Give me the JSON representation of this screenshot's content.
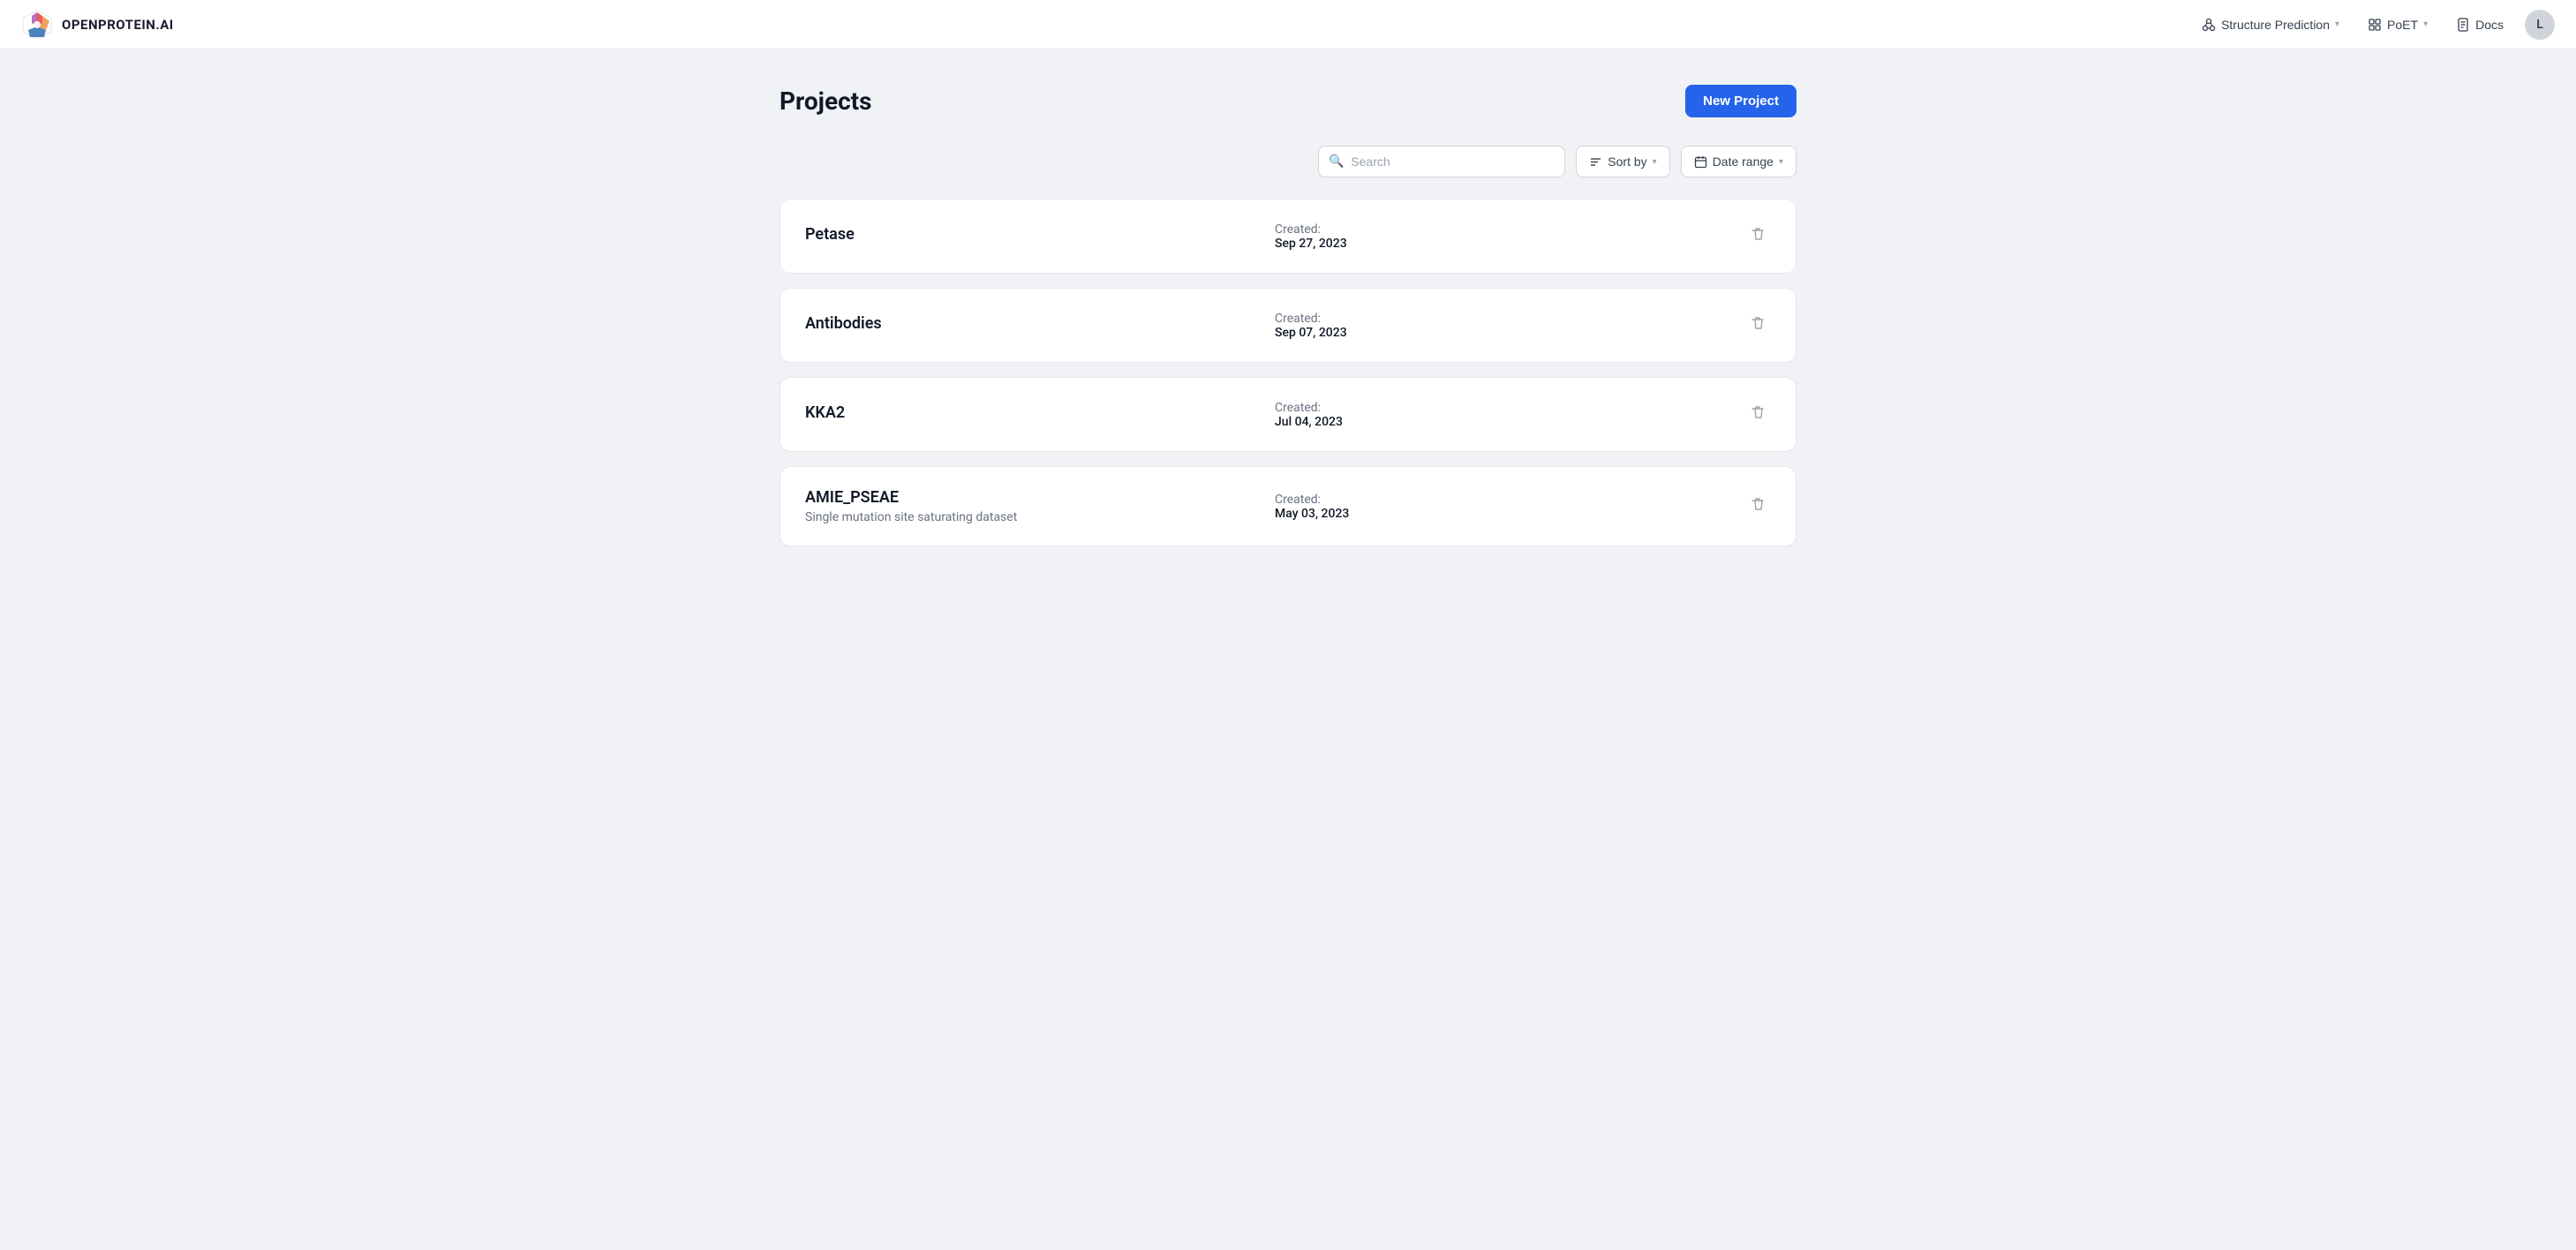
{
  "brand": {
    "name": "OPENPROTEIN.AI"
  },
  "navbar": {
    "structure_prediction_label": "Structure Prediction",
    "poet_label": "PoET",
    "docs_label": "Docs",
    "user_initial": "L"
  },
  "page": {
    "title": "Projects",
    "new_project_btn": "New Project"
  },
  "filters": {
    "search_placeholder": "Search",
    "sort_by_label": "Sort by",
    "date_range_label": "Date range"
  },
  "projects": [
    {
      "name": "Petase",
      "description": "",
      "created_label": "Created:",
      "created_date": "Sep 27, 2023"
    },
    {
      "name": "Antibodies",
      "description": "",
      "created_label": "Created:",
      "created_date": "Sep 07, 2023"
    },
    {
      "name": "KKA2",
      "description": "",
      "created_label": "Created:",
      "created_date": "Jul 04, 2023"
    },
    {
      "name": "AMIE_PSEAE",
      "description": "Single mutation site saturating dataset",
      "created_label": "Created:",
      "created_date": "May 03, 2023"
    }
  ]
}
